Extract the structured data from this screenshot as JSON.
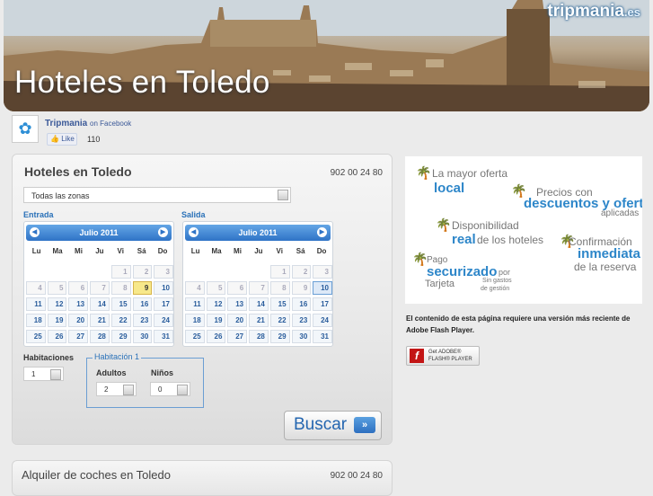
{
  "banner": {
    "title": "Hoteles en Toledo",
    "logo": "tripmania",
    "logo_tld": ".es"
  },
  "facebook": {
    "name": "Tripmania",
    "on": "on Facebook",
    "like": "Like",
    "count": "110"
  },
  "search": {
    "title": "Hoteles en Toledo",
    "phone": "902 00 24 80",
    "zone": "Todas las zonas",
    "entrada_label": "Entrada",
    "salida_label": "Salida",
    "calendars": [
      {
        "month": "Julio 2011",
        "selected_day": 9
      },
      {
        "month": "Julio 2011",
        "selected_day": 10
      }
    ],
    "dows": [
      "Lu",
      "Ma",
      "Mi",
      "Ju",
      "Vi",
      "Sá",
      "Do"
    ],
    "habitaciones_label": "Habitaciones",
    "habitaciones_value": "1",
    "room_label": "Habitación 1",
    "adultos_label": "Adultos",
    "adultos_value": "2",
    "ninos_label": "Niños",
    "ninos_value": "0",
    "buscar_label": "Buscar"
  },
  "cars": {
    "title": "Alquiler de coches en Toledo",
    "phone": "902 00 24 80"
  },
  "promo": {
    "lines": [
      {
        "a": "La mayor oferta",
        "b": "local"
      },
      {
        "a": "Precios con",
        "b": "descuentos y ofertas",
        "c": "aplicadas"
      },
      {
        "a": "Disponibilidad",
        "b": "real",
        "c": "de los hoteles"
      },
      {
        "a": "Confirmación",
        "b": "inmediata",
        "c": "de la reserva"
      },
      {
        "a": "Pago",
        "b": "securizado",
        "c": "por",
        "d": "Tarjeta",
        "e": "Sin gastos",
        "f": "de gestión"
      }
    ]
  },
  "flash": {
    "message": "El contenido de esta página requiere una versión más reciente de Adobe Flash Player.",
    "btn_line1": "Get ADOBE®",
    "btn_line2": "FLASH® PLAYER"
  }
}
